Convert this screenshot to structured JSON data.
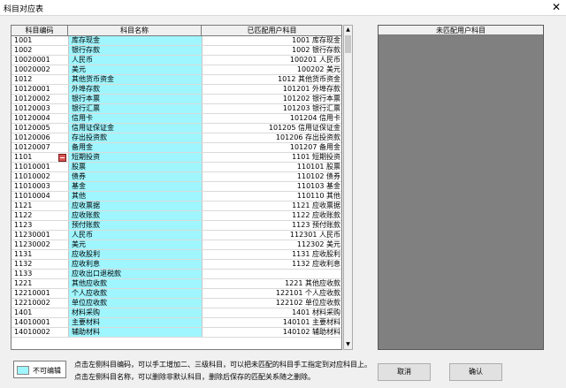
{
  "window": {
    "title": "科目对应表",
    "close_glyph": "✕"
  },
  "left_grid": {
    "headers": [
      "科目编码",
      "科目名称",
      "已匹配用户科目"
    ],
    "rows": [
      {
        "code": "1001",
        "name": "库存现金",
        "match": "1001  库存现金"
      },
      {
        "code": "1002",
        "name": "银行存款",
        "match": "1002  银行存款"
      },
      {
        "code": "10020001",
        "name": "人民币",
        "match": "100201  人民币"
      },
      {
        "code": "10020002",
        "name": "美元",
        "match": "100202  美元"
      },
      {
        "code": "1012",
        "name": "其他货币资金",
        "match": "1012  其他货币资金"
      },
      {
        "code": "10120001",
        "name": "外埠存款",
        "match": "101201  外埠存款"
      },
      {
        "code": "10120002",
        "name": "银行本票",
        "match": "101202  银行本票"
      },
      {
        "code": "10120003",
        "name": "银行汇票",
        "match": "101203  银行汇票"
      },
      {
        "code": "10120004",
        "name": "信用卡",
        "match": "101204  信用卡"
      },
      {
        "code": "10120005",
        "name": "信用证保证金",
        "match": "101205  信用证保证金"
      },
      {
        "code": "10120006",
        "name": "存出投资款",
        "match": "101206  存出投资款"
      },
      {
        "code": "10120007",
        "name": "备用金",
        "match": "101207  备用金"
      },
      {
        "code": "1101",
        "name": "短期投资",
        "match": "1101  短期投资",
        "marked": true
      },
      {
        "code": "11010001",
        "name": "股票",
        "match": "110101  股票"
      },
      {
        "code": "11010002",
        "name": "债券",
        "match": "110102  债券"
      },
      {
        "code": "11010003",
        "name": "基金",
        "match": "110103  基金"
      },
      {
        "code": "11010004",
        "name": "其他",
        "match": "110110  其他"
      },
      {
        "code": "1121",
        "name": "应收票据",
        "match": "1121  应收票据"
      },
      {
        "code": "1122",
        "name": "应收账款",
        "match": "1122  应收账款"
      },
      {
        "code": "1123",
        "name": "预付账款",
        "match": "1123  预付账款"
      },
      {
        "code": "11230001",
        "name": "人民币",
        "match": "112301  人民币"
      },
      {
        "code": "11230002",
        "name": "美元",
        "match": "112302  美元"
      },
      {
        "code": "1131",
        "name": "应收股利",
        "match": "1131  应收股利"
      },
      {
        "code": "1132",
        "name": "应收利息",
        "match": "1132  应收利息"
      },
      {
        "code": "1133",
        "name": "应收出口退税款",
        "match": ""
      },
      {
        "code": "1221",
        "name": "其他应收款",
        "match": "1221  其他应收款"
      },
      {
        "code": "12210001",
        "name": "个人应收款",
        "match": "122101  个人应收款"
      },
      {
        "code": "12210002",
        "name": "单位应收款",
        "match": "122102  单位应收款"
      },
      {
        "code": "1401",
        "name": "材料采购",
        "match": "1401  材料采购"
      },
      {
        "code": "14010001",
        "name": "主要材料",
        "match": "140101  主要材料"
      },
      {
        "code": "14010002",
        "name": "辅助材料",
        "match": "140102  辅助材料"
      }
    ]
  },
  "scrollbar": {
    "up_glyph": "▲",
    "down_glyph": "▼"
  },
  "right_panel": {
    "header": "未匹配用户科目"
  },
  "legend": {
    "label": "不可编辑",
    "color": "#9ff6ff"
  },
  "hints": [
    "点击左侧科目编码，可以手工增加二、三级科目，可以把未匹配的科目手工指定到对应科目上。",
    "点击左侧科目名称，可以删除非默认科目，删除后保存的匹配关系随之删除。"
  ],
  "buttons": {
    "cancel": "取消",
    "ok": "确认"
  }
}
